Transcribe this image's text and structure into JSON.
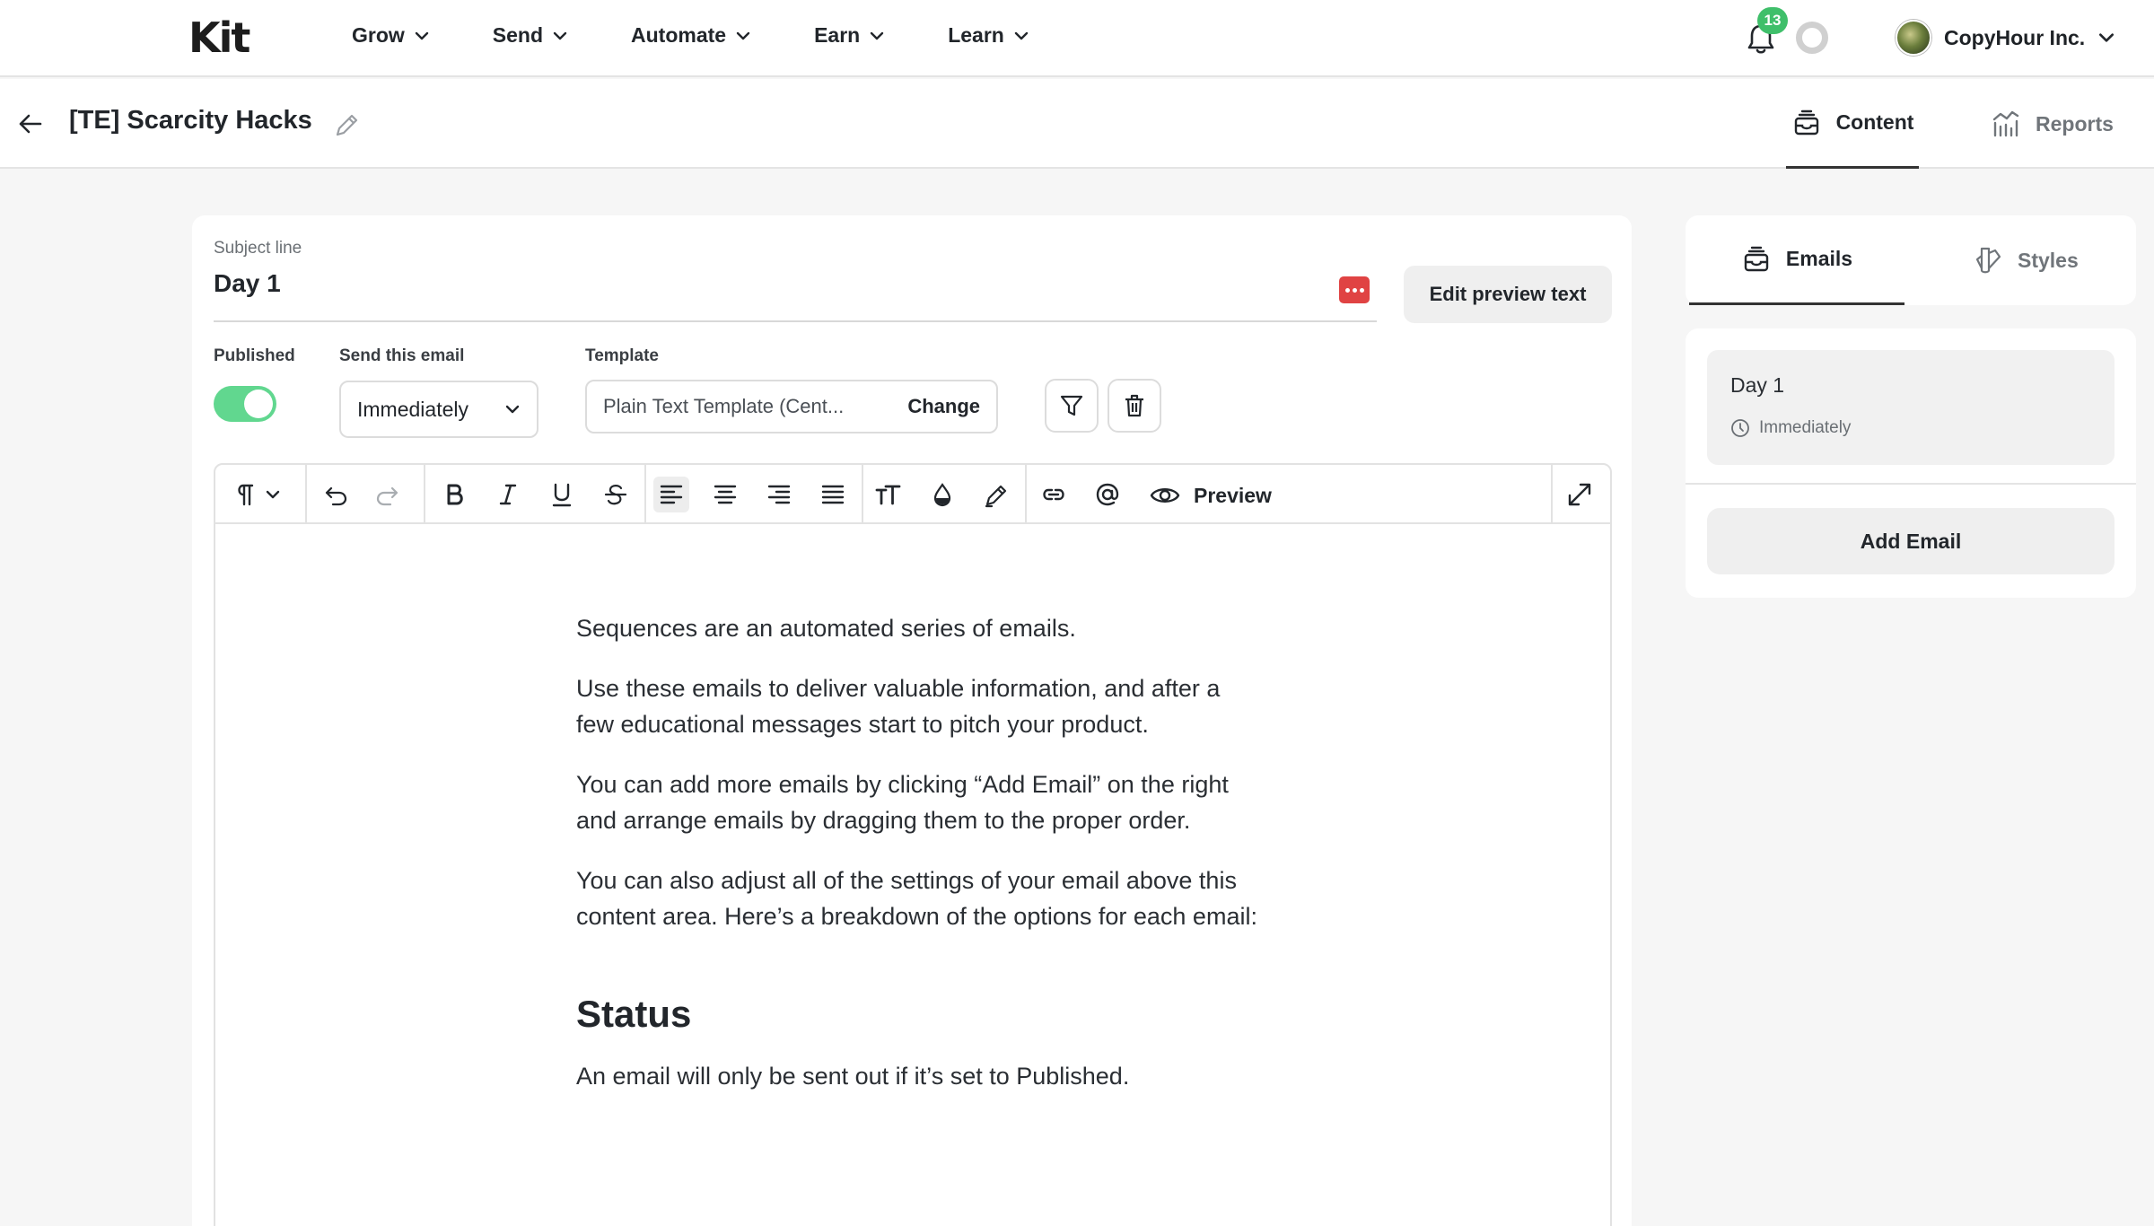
{
  "nav": {
    "logo": "Kit",
    "items": [
      {
        "label": "Grow"
      },
      {
        "label": "Send"
      },
      {
        "label": "Automate"
      },
      {
        "label": "Earn"
      },
      {
        "label": "Learn"
      }
    ],
    "notifications_count": "13",
    "account_name": "CopyHour Inc."
  },
  "subheader": {
    "sequence_title": "[TE] Scarcity Hacks",
    "tabs": [
      {
        "label": "Content",
        "active": true
      },
      {
        "label": "Reports",
        "active": false
      }
    ]
  },
  "editor": {
    "subject_label": "Subject line",
    "subject_value": "Day 1",
    "edit_preview_label": "Edit preview text",
    "published_label": "Published",
    "published": true,
    "send_label": "Send this email",
    "send_value": "Immediately",
    "template_label": "Template",
    "template_value": "Plain Text Template (Cent...",
    "template_change": "Change",
    "preview_label": "Preview",
    "body": {
      "p1": "Sequences are an automated series of emails.",
      "p2": "Use these emails to deliver valuable information, and after a few educational messages start to pitch your product.",
      "p3": "You can add more emails by clicking “Add Email” on the right and arrange emails by dragging them to the proper order.",
      "p4": "You can also adjust all of the settings of your email above this content area. Here’s a breakdown of the options for each email:",
      "h_status": "Status",
      "p5": "An email will only be sent out if it’s set to Published."
    }
  },
  "right_panel": {
    "tabs": [
      {
        "label": "Emails",
        "active": true
      },
      {
        "label": "Styles",
        "active": false
      }
    ],
    "emails": [
      {
        "title": "Day 1",
        "when": "Immediately"
      }
    ],
    "add_email_label": "Add Email"
  },
  "colors": {
    "toggle_on": "#61d78f",
    "badge": "#3fbf6a",
    "emoji_button": "#e04343",
    "page_background": "#f6f6f6"
  }
}
